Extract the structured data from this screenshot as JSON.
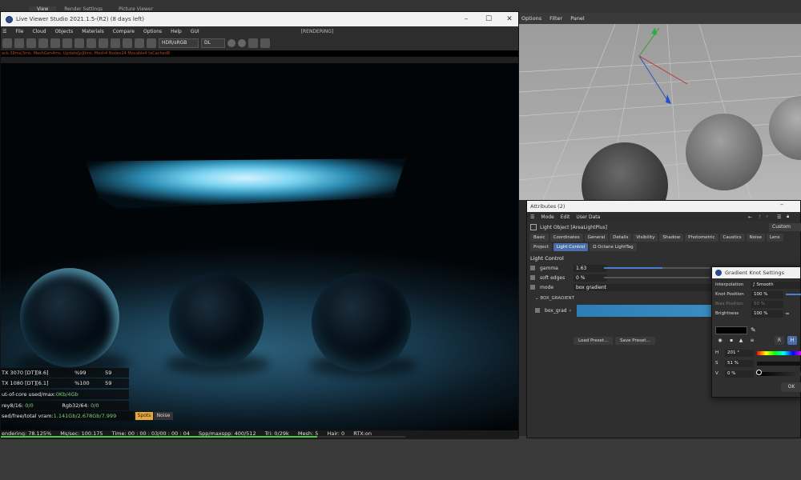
{
  "host": {
    "tabs": [
      "View",
      "Render Settings",
      "Picture Viewer"
    ],
    "viewport_menu": [
      "Options",
      "Filter",
      "Panel"
    ]
  },
  "live_viewer": {
    "title": "Live Viewer Studio 2021.1.5-(R2) (8 days left)",
    "menu": [
      "File",
      "Cloud",
      "Objects",
      "Materials",
      "Compare",
      "Options",
      "Help",
      "GUI"
    ],
    "rendering_label": "[RENDERING]",
    "toolbar": {
      "color_space": "HDR/sRGB",
      "mode": "DL"
    },
    "stats_line": "ack:38ms/3ms. MeshGen4ms, Update[p]0ms. Mesh4 Nodes24 Movable4 txCached8",
    "overlay": {
      "gpu1_name": "TX 3070 [DT][8.6]",
      "gpu1_pct": "%99",
      "gpu1_temp": "59",
      "gpu2_name": "TX 1080 [DT][6.1]",
      "gpu2_pct": "%100",
      "gpu2_temp": "59",
      "core_label": "ut-of-core used/max:",
      "core_value": "0Kb/4Gb",
      "grey_label": "rey8/16:",
      "grey_value": "0/0",
      "rgb_label": "Rgb32/64:",
      "rgb_value": "0/0",
      "vram_label": "sed/free/total vram:",
      "vram_value": "1.141Gb/2.678Gb/7.999",
      "spots": "Spots",
      "noise": "Noise"
    },
    "status": {
      "rendering": "endering: 78.125%",
      "ms_sec": "Ms/sec: 100.175",
      "time": "Time: 00 : 00 : 03/00 : 00 : 04",
      "spp": "Spp/maxspp: 400/512",
      "tri": "Tri: 0/29k",
      "mesh": "Mesh: 5",
      "hair": "Hair: 0",
      "rtx": "RTX:on"
    },
    "progress": 0.78125
  },
  "attributes": {
    "title": "Attributes (2)",
    "menu": [
      "Mode",
      "Edit",
      "User Data"
    ],
    "object": "Light Object [AreaLightPlus]",
    "preset": "Custom",
    "tabs_row1": [
      "Basic",
      "Coordinates",
      "General",
      "Details",
      "Visibility",
      "Shadow",
      "Photometric",
      "Caustics",
      "Noise",
      "Lens"
    ],
    "tabs_row2": [
      "Project",
      "Light Control",
      "Ω Octane LightTag"
    ],
    "active_tab": "Light Control",
    "section": "Light Control",
    "gamma_label": "gamma",
    "gamma_value": "1.63",
    "gamma_fraction": 0.55,
    "soft_label": "soft edges",
    "soft_value": "0 %",
    "mode_label": "mode",
    "mode_value": "box gradient",
    "grad_section": "BOX_GRADIENT",
    "grad_label": "box_grad",
    "load_preset": "Load Preset...",
    "save_preset": "Save Preset..."
  },
  "knot": {
    "title": "Gradient Knot Settings",
    "interp_label": "Interpolation",
    "interp_value": "Smooth",
    "knot_pos_label": "Knot Position",
    "knot_pos_value": "100 %",
    "bias_label": "Bias Position",
    "bias_value": "50 %",
    "bright_label": "Brightness",
    "bright_value": "100 %",
    "r_btn": "R",
    "h_btn": "H",
    "h_label": "H",
    "h_value": "201 °",
    "s_label": "S",
    "s_value": "51 %",
    "v_label": "V",
    "v_value": "0 %",
    "ok": "OK"
  }
}
